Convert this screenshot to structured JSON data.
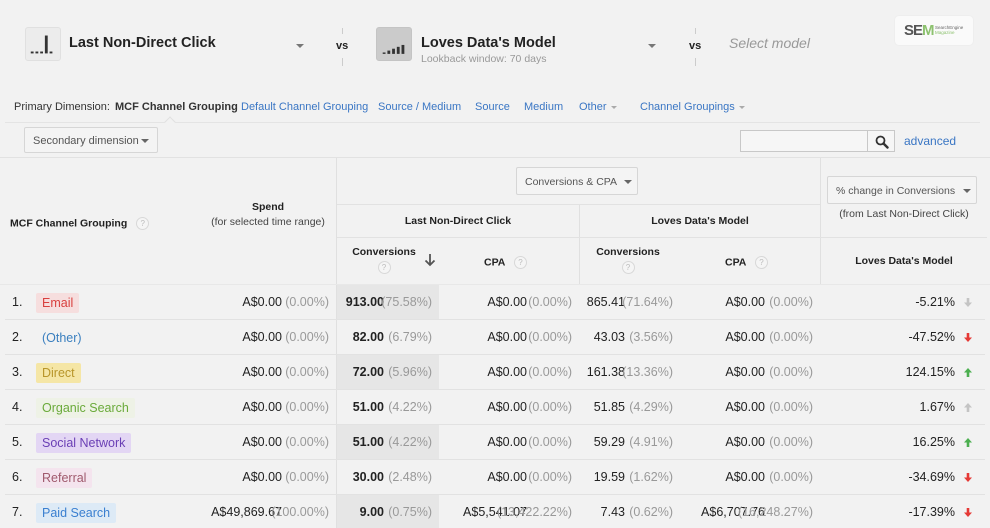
{
  "models": {
    "model_a": {
      "name": "Last Non-Direct Click",
      "icon": "last-non-direct-click-icon"
    },
    "vs_label": "vs",
    "model_b": {
      "name": "Loves Data's Model",
      "subtitle": "Lookback window: 70 days",
      "icon": "custom-model-icon"
    },
    "model_c": {
      "placeholder": "Select model"
    }
  },
  "logo": {
    "mark_se": "SE",
    "mark_m": "M",
    "line1": "SearchEngine",
    "line2": "Magazine"
  },
  "primary_dimension": {
    "label": "Primary Dimension:",
    "active": "MCF Channel Grouping",
    "links": [
      "Default Channel Grouping",
      "Source / Medium",
      "Source",
      "Medium",
      "Other",
      "Channel Groupings"
    ]
  },
  "toolbar": {
    "secondary_dimension": "Secondary dimension",
    "search_value": "",
    "advanced_label": "advanced"
  },
  "table": {
    "headers": {
      "channel": "MCF Channel Grouping",
      "spend": "Spend",
      "spend_sub": "(for selected time range)",
      "metric_selector": "Conversions & CPA",
      "group_a": "Last Non-Direct Click",
      "group_b": "Loves Data's Model",
      "conversions": "Conversions",
      "cpa": "CPA",
      "change_selector": "% change in Conversions",
      "change_sub": "(from Last Non-Direct Click)",
      "change_model": "Loves Data's Model",
      "help": "?"
    },
    "rows": [
      {
        "index": "1.",
        "channel": "Email",
        "badge_bg": "#f6dede",
        "badge_fg": "#d9403f",
        "spend": "A$0.00",
        "spend_pct": "(0.00%)",
        "a_conv": "913.00",
        "a_conv_pct": "(75.58%)",
        "a_cpa": "A$0.00",
        "a_cpa_pct": "(0.00%)",
        "b_conv": "865.41",
        "b_conv_pct": "(71.64%)",
        "b_cpa": "A$0.00",
        "b_cpa_pct": "(0.00%)",
        "change": "-5.21%",
        "trend": "down-neutral"
      },
      {
        "index": "2.",
        "channel": "(Other)",
        "badge_bg": "transparent",
        "badge_fg": "#3a7fbf",
        "spend": "A$0.00",
        "spend_pct": "(0.00%)",
        "a_conv": "82.00",
        "a_conv_pct": "(6.79%)",
        "a_cpa": "A$0.00",
        "a_cpa_pct": "(0.00%)",
        "b_conv": "43.03",
        "b_conv_pct": "(3.56%)",
        "b_cpa": "A$0.00",
        "b_cpa_pct": "(0.00%)",
        "change": "-47.52%",
        "trend": "down"
      },
      {
        "index": "3.",
        "channel": "Direct",
        "badge_bg": "#f5e6a6",
        "badge_fg": "#b8952a",
        "spend": "A$0.00",
        "spend_pct": "(0.00%)",
        "a_conv": "72.00",
        "a_conv_pct": "(5.96%)",
        "a_cpa": "A$0.00",
        "a_cpa_pct": "(0.00%)",
        "b_conv": "161.38",
        "b_conv_pct": "(13.36%)",
        "b_cpa": "A$0.00",
        "b_cpa_pct": "(0.00%)",
        "change": "124.15%",
        "trend": "up"
      },
      {
        "index": "4.",
        "channel": "Organic Search",
        "badge_bg": "#eef2e6",
        "badge_fg": "#6aaa3a",
        "spend": "A$0.00",
        "spend_pct": "(0.00%)",
        "a_conv": "51.00",
        "a_conv_pct": "(4.22%)",
        "a_cpa": "A$0.00",
        "a_cpa_pct": "(0.00%)",
        "b_conv": "51.85",
        "b_conv_pct": "(4.29%)",
        "b_cpa": "A$0.00",
        "b_cpa_pct": "(0.00%)",
        "change": "1.67%",
        "trend": "up-neutral"
      },
      {
        "index": "5.",
        "channel": "Social Network",
        "badge_bg": "#e3d6f4",
        "badge_fg": "#6a3fb5",
        "spend": "A$0.00",
        "spend_pct": "(0.00%)",
        "a_conv": "51.00",
        "a_conv_pct": "(4.22%)",
        "a_cpa": "A$0.00",
        "a_cpa_pct": "(0.00%)",
        "b_conv": "59.29",
        "b_conv_pct": "(4.91%)",
        "b_cpa": "A$0.00",
        "b_cpa_pct": "(0.00%)",
        "change": "16.25%",
        "trend": "up"
      },
      {
        "index": "6.",
        "channel": "Referral",
        "badge_bg": "#f4e4ee",
        "badge_fg": "#a05a6e",
        "spend": "A$0.00",
        "spend_pct": "(0.00%)",
        "a_conv": "30.00",
        "a_conv_pct": "(2.48%)",
        "a_cpa": "A$0.00",
        "a_cpa_pct": "(0.00%)",
        "b_conv": "19.59",
        "b_conv_pct": "(1.62%)",
        "b_cpa": "A$0.00",
        "b_cpa_pct": "(0.00%)",
        "change": "-34.69%",
        "trend": "down"
      },
      {
        "index": "7.",
        "channel": "Paid Search",
        "badge_bg": "#ddeaf6",
        "badge_fg": "#3a7fd0",
        "spend": "A$49,869.67",
        "spend_pct": "(100.00%)",
        "a_conv": "9.00",
        "a_conv_pct": "(0.75%)",
        "a_cpa": "A$5,541.07",
        "a_cpa_pct": "(13,422.22%)",
        "b_conv": "7.43",
        "b_conv_pct": "(0.62%)",
        "b_cpa": "A$6,707.76",
        "b_cpa_pct": "(16,248.27%)",
        "change": "-17.39%",
        "trend": "down"
      }
    ]
  },
  "colors": {
    "link": "#3a76c4",
    "trend_up": "#4caf50",
    "trend_down": "#e53935",
    "trend_neutral": "#c4c4c4"
  }
}
